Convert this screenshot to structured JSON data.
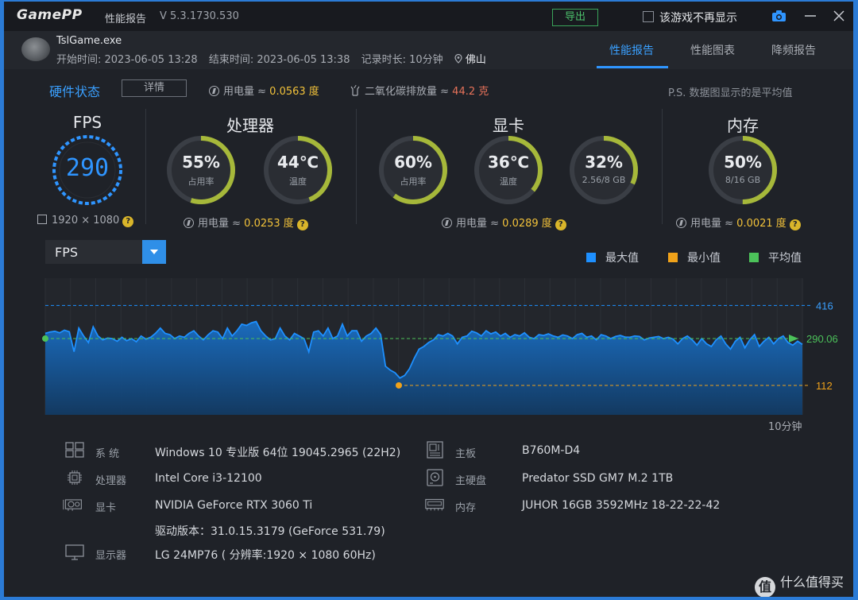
{
  "titlebar": {
    "logo": "GamePP",
    "title": "性能报告",
    "version": "V 5.3.1730.530",
    "export_label": "导出",
    "no_show_label": "该游戏不再显示"
  },
  "session": {
    "game_name": "TslGame.exe",
    "start": "开始时间: 2023-06-05 13:28",
    "end": "结束时间: 2023-06-05 13:38",
    "duration": "记录时长: 10分钟",
    "location": "佛山"
  },
  "tabs": [
    {
      "label": "性能报告",
      "active": true
    },
    {
      "label": "性能图表",
      "active": false
    },
    {
      "label": "降频报告",
      "active": false
    }
  ],
  "hardware": {
    "title": "硬件状态",
    "detail_label": "详情",
    "power_label": "用电量 ≈ ",
    "power_value": "0.0563 度",
    "co2_label": "二氧化碳排放量 ≈ ",
    "co2_value": "44.2 克",
    "note": "P.S. 数据图显示的是平均值"
  },
  "fps_panel": {
    "title": "FPS",
    "value": "290",
    "resolution": "1920 × 1080"
  },
  "cpu_panel": {
    "title": "处理器",
    "usage": {
      "value": "55%",
      "label": "占用率",
      "fraction": 0.55
    },
    "temp": {
      "value": "44℃",
      "label": "温度",
      "fraction": 0.44
    },
    "power_label": "用电量 ≈ ",
    "power_value": "0.0253 度"
  },
  "gpu_panel": {
    "title": "显卡",
    "usage": {
      "value": "60%",
      "label": "占用率",
      "fraction": 0.6
    },
    "temp": {
      "value": "36℃",
      "label": "温度",
      "fraction": 0.36
    },
    "vram": {
      "value": "32%",
      "label": "2.56/8 GB",
      "fraction": 0.32
    },
    "power_label": "用电量 ≈ ",
    "power_value": "0.0289 度"
  },
  "mem_panel": {
    "title": "内存",
    "usage": {
      "value": "50%",
      "label": "8/16 GB",
      "fraction": 0.5
    },
    "power_label": "用电量 ≈ ",
    "power_value": "0.0021 度"
  },
  "chart_controls": {
    "metric_selected": "FPS",
    "legend": [
      {
        "label": "最大值",
        "color": "#1e90ff"
      },
      {
        "label": "最小值",
        "color": "#f0a21a"
      },
      {
        "label": "平均值",
        "color": "#4cc25a"
      }
    ],
    "duration_label": "10分钟"
  },
  "chart_data": {
    "type": "area",
    "ylim": [
      0,
      520
    ],
    "max": 416,
    "min": 112,
    "avg": 290.06,
    "max_label": "416",
    "min_label": "112",
    "avg_label": "290.06",
    "values": [
      310,
      315,
      318,
      312,
      322,
      316,
      240,
      330,
      300,
      275,
      335,
      300,
      285,
      292,
      290,
      280,
      295,
      282,
      290,
      278,
      300,
      288,
      295,
      310,
      330,
      310,
      305,
      290,
      300,
      295,
      310,
      320,
      300,
      285,
      305,
      320,
      315,
      290,
      330,
      300,
      320,
      345,
      340,
      350,
      355,
      320,
      300,
      285,
      290,
      330,
      300,
      285,
      310,
      300,
      290,
      240,
      315,
      320,
      300,
      330,
      290,
      300,
      345,
      300,
      320,
      320,
      280,
      300,
      310,
      330,
      305,
      185,
      170,
      160,
      140,
      150,
      175,
      215,
      250,
      260,
      275,
      285,
      305,
      300,
      310,
      300,
      270,
      295,
      300,
      318,
      312,
      300,
      320,
      308,
      315,
      300,
      310,
      295,
      305,
      300,
      312,
      295,
      290,
      305,
      302,
      308,
      300,
      295,
      304,
      300,
      290,
      305,
      310,
      295,
      300,
      285,
      305,
      300,
      290,
      298,
      302,
      296,
      295,
      300,
      298,
      285,
      292,
      295,
      298,
      290,
      295,
      288,
      270,
      290,
      300,
      285,
      265,
      290,
      270,
      260,
      285,
      300,
      270,
      250,
      280,
      295,
      255,
      285,
      305,
      260,
      280,
      295,
      270,
      290,
      300,
      275,
      265,
      280,
      268
    ]
  },
  "sysinfo": {
    "os_label": "系  统",
    "os_value": "Windows 10 专业版 64位 19045.2965 (22H2)",
    "cpu_label": "处理器",
    "cpu_value": "Intel Core i3-12100",
    "gpu_label": "显卡",
    "gpu_value": "NVIDIA GeForce RTX 3060 Ti",
    "driver_value": "驱动版本：31.0.15.3179 (GeForce 531.79)",
    "monitor_label": "显示器",
    "monitor_value": "LG 24MP76 ( 分辨率:1920 × 1080 60Hz)",
    "board_label": "主板",
    "board_value": "B760M-D4",
    "disk_label": "主硬盘",
    "disk_value": "Predator SSD GM7 M.2 1TB",
    "ram_label": "内存",
    "ram_value": "JUHOR 16GB 3592MHz 18-22-22-42"
  },
  "watermark": {
    "badge": "值",
    "text": "什么值得买"
  }
}
